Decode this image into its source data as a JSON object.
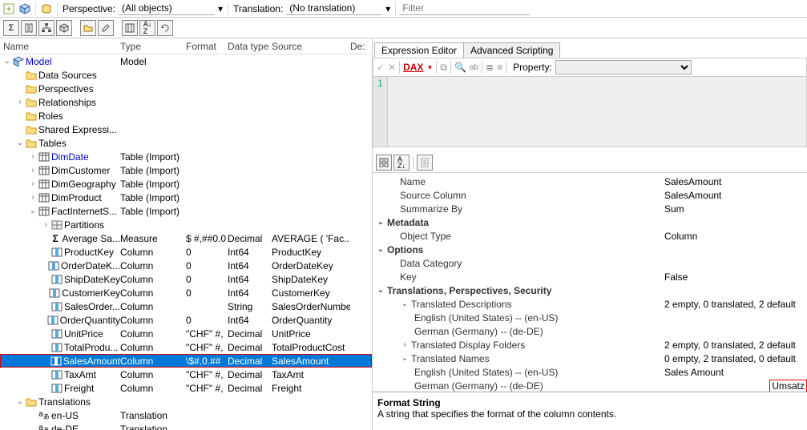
{
  "toolbar": {
    "perspective_label": "Perspective:",
    "perspective_value": "(All objects)",
    "translation_label": "Translation:",
    "translation_value": "(No translation)",
    "filter_placeholder": "Filter"
  },
  "tree_headers": {
    "name": "Name",
    "type": "Type",
    "format": "Format",
    "dtype": "Data type",
    "source": "Source",
    "des": "De:"
  },
  "tree": [
    {
      "ind": 0,
      "tw": "v",
      "ico": "cube",
      "name": "Model",
      "type": "Model",
      "link": true
    },
    {
      "ind": 1,
      "tw": "",
      "ico": "folder",
      "name": "Data Sources"
    },
    {
      "ind": 1,
      "tw": "",
      "ico": "folder",
      "name": "Perspectives"
    },
    {
      "ind": 1,
      "tw": ">",
      "ico": "folder",
      "name": "Relationships"
    },
    {
      "ind": 1,
      "tw": "",
      "ico": "folder",
      "name": "Roles"
    },
    {
      "ind": 1,
      "tw": "",
      "ico": "folder",
      "name": "Shared Expressi..."
    },
    {
      "ind": 1,
      "tw": "v",
      "ico": "folder",
      "name": "Tables"
    },
    {
      "ind": 2,
      "tw": ">",
      "ico": "table",
      "name": "DimDate",
      "type": "Table (Import)",
      "link": true
    },
    {
      "ind": 2,
      "tw": ">",
      "ico": "table",
      "name": "DimCustomer",
      "type": "Table (Import)"
    },
    {
      "ind": 2,
      "tw": ">",
      "ico": "table",
      "name": "DimGeography",
      "type": "Table (Import)"
    },
    {
      "ind": 2,
      "tw": ">",
      "ico": "table",
      "name": "DimProduct",
      "type": "Table (Import)"
    },
    {
      "ind": 2,
      "tw": "v",
      "ico": "table",
      "name": "FactInternetS...",
      "type": "Table (Import)"
    },
    {
      "ind": 3,
      "tw": ">",
      "ico": "part",
      "name": "Partitions"
    },
    {
      "ind": 3,
      "tw": "",
      "ico": "sigma",
      "name": "Average Sa...",
      "type": "Measure",
      "format": "$ #,##0.0",
      "dtype": "Decimal",
      "source": "AVERAGE ( 'Fac..."
    },
    {
      "ind": 3,
      "tw": "",
      "ico": "col",
      "name": "ProductKey",
      "type": "Column",
      "format": "0",
      "dtype": "Int64",
      "source": "ProductKey"
    },
    {
      "ind": 3,
      "tw": "",
      "ico": "col",
      "name": "OrderDateK...",
      "type": "Column",
      "format": "0",
      "dtype": "Int64",
      "source": "OrderDateKey"
    },
    {
      "ind": 3,
      "tw": "",
      "ico": "col",
      "name": "ShipDateKey",
      "type": "Column",
      "format": "0",
      "dtype": "Int64",
      "source": "ShipDateKey"
    },
    {
      "ind": 3,
      "tw": "",
      "ico": "col",
      "name": "CustomerKey",
      "type": "Column",
      "format": "0",
      "dtype": "Int64",
      "source": "CustomerKey"
    },
    {
      "ind": 3,
      "tw": "",
      "ico": "col",
      "name": "SalesOrder...",
      "type": "Column",
      "format": "",
      "dtype": "String",
      "source": "SalesOrderNumber"
    },
    {
      "ind": 3,
      "tw": "",
      "ico": "col",
      "name": "OrderQuantity",
      "type": "Column",
      "format": "0",
      "dtype": "Int64",
      "source": "OrderQuantity"
    },
    {
      "ind": 3,
      "tw": "",
      "ico": "col",
      "name": "UnitPrice",
      "type": "Column",
      "format": "\"CHF\" #,",
      "dtype": "Decimal",
      "source": "UnitPrice"
    },
    {
      "ind": 3,
      "tw": "",
      "ico": "col",
      "name": "TotalProdu...",
      "type": "Column",
      "format": "\"CHF\" #,",
      "dtype": "Decimal",
      "source": "TotalProductCost"
    },
    {
      "ind": 3,
      "tw": "",
      "ico": "col",
      "name": "SalesAmount",
      "type": "Column",
      "format": "\\$#,0.##",
      "dtype": "Decimal",
      "source": "SalesAmount",
      "sel": true,
      "box": true
    },
    {
      "ind": 3,
      "tw": "",
      "ico": "col",
      "name": "TaxAmt",
      "type": "Column",
      "format": "\"CHF\" #,",
      "dtype": "Decimal",
      "source": "TaxAmt"
    },
    {
      "ind": 3,
      "tw": "",
      "ico": "col",
      "name": "Freight",
      "type": "Column",
      "format": "\"CHF\" #,",
      "dtype": "Decimal",
      "source": "Freight"
    },
    {
      "ind": 1,
      "tw": "v",
      "ico": "folder",
      "name": "Translations"
    },
    {
      "ind": 2,
      "tw": "",
      "ico": "lang",
      "name": "en-US",
      "type": "Translation"
    },
    {
      "ind": 2,
      "tw": "",
      "ico": "lang",
      "name": "de-DE",
      "type": "Translation"
    }
  ],
  "right_tabs": {
    "a": "Expression Editor",
    "b": "Advanced Scripting"
  },
  "editor": {
    "dax": "DAX",
    "prop_label": "Property:",
    "line": "1"
  },
  "props": [
    {
      "k": "Name",
      "v": "SalesAmount",
      "ind": 1
    },
    {
      "k": "Source Column",
      "v": "SalesAmount",
      "ind": 1
    },
    {
      "k": "Summarize By",
      "v": "Sum",
      "ind": 1
    },
    {
      "cat": true,
      "chev": "v",
      "k": "Metadata"
    },
    {
      "k": "Object Type",
      "v": "Column",
      "ind": 1
    },
    {
      "cat": true,
      "chev": "v",
      "k": "Options"
    },
    {
      "k": "Data Category",
      "v": "",
      "ind": 1
    },
    {
      "k": "Key",
      "v": "False",
      "ind": 1
    },
    {
      "cat": true,
      "chev": "v",
      "k": "Translations, Perspectives, Security"
    },
    {
      "chev": "v",
      "k": "Translated Descriptions",
      "v": "2 empty, 0 translated, 2 default",
      "ind": 1
    },
    {
      "k": "English (United States) -- (en-US)",
      "v": "",
      "ind": 2
    },
    {
      "k": "German (Germany) -- (de-DE)",
      "v": "",
      "ind": 2
    },
    {
      "chev": ">",
      "k": "Translated Display Folders",
      "v": "2 empty, 0 translated, 2 default",
      "ind": 1
    },
    {
      "chev": "v",
      "k": "Translated Names",
      "v": "0 empty, 2 translated, 0 default",
      "ind": 1
    },
    {
      "k": "English (United States) -- (en-US)",
      "v": "Sales Amount",
      "ind": 2
    },
    {
      "k": "German (Germany) -- (de-DE)",
      "v": "Umsatz",
      "ind": 2,
      "box": true
    }
  ],
  "format_help": {
    "title": "Format String",
    "body": "A string that specifies the format of the column contents."
  }
}
